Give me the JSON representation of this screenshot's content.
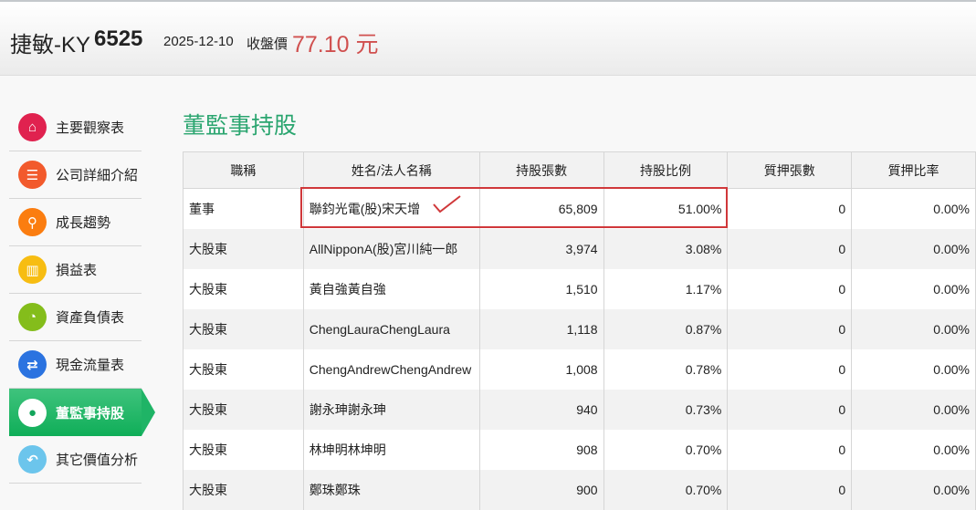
{
  "header": {
    "company": "捷敏-KY",
    "code": "6525",
    "date": "2025-12-10",
    "close_label": "收盤價",
    "price": "77.10 元"
  },
  "sidebar": {
    "items": [
      {
        "label": "主要觀察表",
        "icon": "home-icon",
        "color": "#e0224f",
        "glyph": "⌂"
      },
      {
        "label": "公司詳細介紹",
        "icon": "list-icon",
        "color": "#f25a2c",
        "glyph": "☰"
      },
      {
        "label": "成長趨勢",
        "icon": "search-icon",
        "color": "#fb7d10",
        "glyph": "⚲"
      },
      {
        "label": "損益表",
        "icon": "bar-chart-icon",
        "color": "#f7bd12",
        "glyph": "▥"
      },
      {
        "label": "資產負債表",
        "icon": "pie-chart-icon",
        "color": "#84bd1b",
        "glyph": "◔"
      },
      {
        "label": "現金流量表",
        "icon": "exchange-icon",
        "color": "#2b73e0",
        "glyph": "⇄"
      },
      {
        "label": "董監事持股",
        "icon": "user-icon",
        "color": "#ffffff",
        "glyph": "●"
      },
      {
        "label": "其它價值分析",
        "icon": "reply-icon",
        "color": "#6cc5ec",
        "glyph": "↶"
      }
    ],
    "active": 6
  },
  "page_title": "董監事持股",
  "table": {
    "headers": [
      "職稱",
      "姓名/法人名稱",
      "持股張數",
      "持股比例",
      "質押張數",
      "質押比率"
    ],
    "rows": [
      [
        "董事",
        "聯鈞光電(股)宋天增",
        "65,809",
        "51.00%",
        "0",
        "0.00%"
      ],
      [
        "大股東",
        "AllNipponA(股)宮川純一郎",
        "3,974",
        "3.08%",
        "0",
        "0.00%"
      ],
      [
        "大股東",
        "黃自強黃自強",
        "1,510",
        "1.17%",
        "0",
        "0.00%"
      ],
      [
        "大股東",
        "ChengLauraChengLaura",
        "1,118",
        "0.87%",
        "0",
        "0.00%"
      ],
      [
        "大股東",
        "ChengAndrewChengAndrew",
        "1,008",
        "0.78%",
        "0",
        "0.00%"
      ],
      [
        "大股東",
        "謝永珅謝永珅",
        "940",
        "0.73%",
        "0",
        "0.00%"
      ],
      [
        "大股東",
        "林坤明林坤明",
        "908",
        "0.70%",
        "0",
        "0.00%"
      ],
      [
        "大股東",
        "鄭珠鄭珠",
        "900",
        "0.70%",
        "0",
        "0.00%"
      ]
    ]
  }
}
